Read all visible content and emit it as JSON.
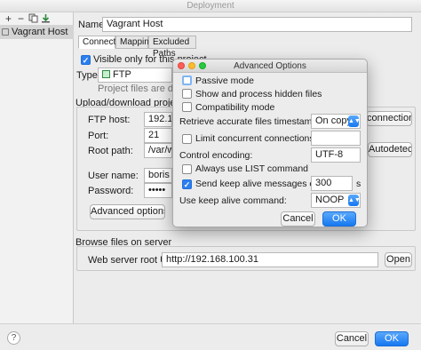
{
  "window": {
    "title": "Deployment"
  },
  "sidebar": {
    "toolbar": {
      "add": "+",
      "remove": "−"
    },
    "items": [
      {
        "label": "Vagrant Host"
      }
    ]
  },
  "main": {
    "name_label": "Name:",
    "name_value": "Vagrant Host",
    "tabs": [
      {
        "label": "Connection"
      },
      {
        "label": "Mappings"
      },
      {
        "label": "Excluded Paths"
      }
    ],
    "visible_only": {
      "label": "Visible only for this project"
    },
    "type_label": "Type:",
    "type_value": "FTP",
    "project_files_text": "Project files are deploy",
    "section_title": "Upload/download project files",
    "ftp_host_label": "FTP host:",
    "ftp_host_value": "192.16",
    "connection_button": "connection...",
    "port_label": "Port:",
    "port_value": "21",
    "root_path_label": "Root path:",
    "root_path_value": "/var/w",
    "autodetect_button": "Autodetect",
    "user_label": "User name:",
    "user_value": "boris",
    "password_label": "Password:",
    "password_value": "•••••",
    "advanced_button": "Advanced options...",
    "browse_title": "Browse files on server",
    "web_root_label": "Web server root URL:",
    "web_root_value": "http://192.168.100.31",
    "open_button": "Open"
  },
  "footer": {
    "help": "?",
    "cancel": "Cancel",
    "ok": "OK"
  },
  "dialog": {
    "title": "Advanced Options",
    "passive_mode": {
      "label": "Passive mode",
      "checked": false
    },
    "show_hidden": {
      "label": "Show and process hidden files",
      "checked": false
    },
    "compat_mode": {
      "label": "Compatibility mode",
      "checked": false
    },
    "timestamps_label": "Retrieve accurate files timestamps:",
    "timestamps_value": "On copy",
    "limit_conn": {
      "label": "Limit concurrent connections:",
      "checked": false
    },
    "encoding_label": "Control encoding:",
    "encoding_value": "UTF-8",
    "always_list": {
      "label": "Always use LIST command",
      "checked": false
    },
    "keep_alive": {
      "label": "Send keep alive messages each:",
      "checked": true
    },
    "keep_alive_value": "300",
    "keep_alive_unit": "s",
    "keep_alive_cmd_label": "Use keep alive command:",
    "keep_alive_cmd_value": "NOOP",
    "cancel": "Cancel",
    "ok": "OK"
  },
  "colors": {
    "accent": "#1677f0",
    "selection": "#d4d4d4"
  },
  "icons": [
    "add-icon",
    "remove-icon",
    "copy-icon",
    "import-icon",
    "server-icon",
    "ftp-icon",
    "help-icon",
    "chevron-updown-icon"
  ]
}
